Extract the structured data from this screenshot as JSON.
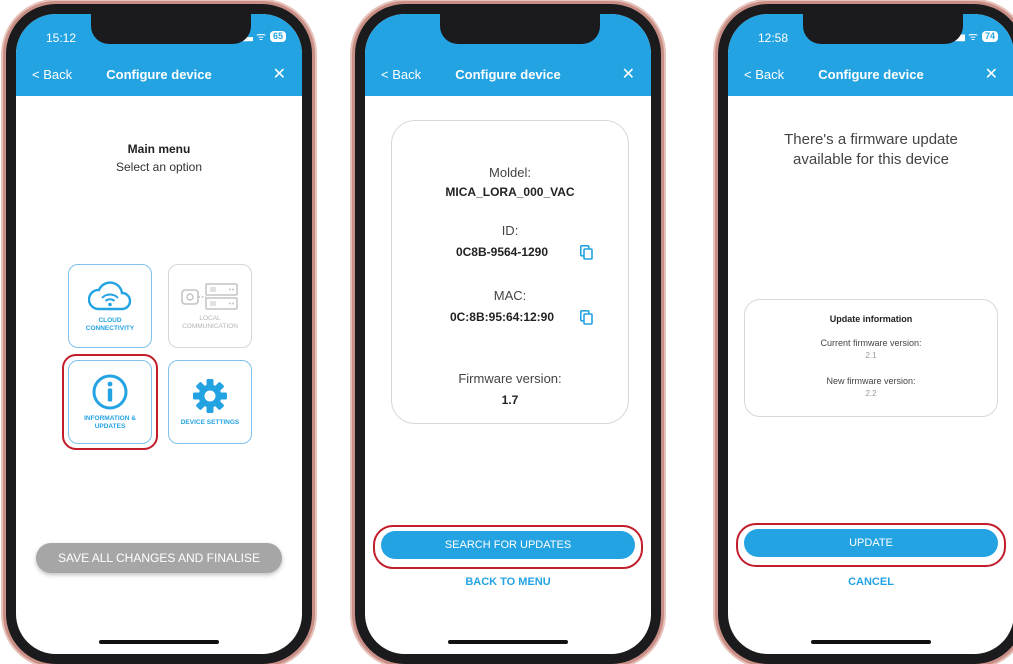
{
  "phone1": {
    "time": "15:12",
    "battery": "65",
    "back": "< Back",
    "title": "Configure device",
    "close": "✕",
    "menu_title": "Main menu",
    "menu_subtitle": "Select an option",
    "tiles": {
      "cloud": "CLOUD CONNECTIVITY",
      "local": "LOCAL COMMUNICATION",
      "info": "INFORMATION & UPDATES",
      "settings": "DEVICE SETTINGS"
    },
    "save_button": "SAVE ALL CHANGES AND FINALISE"
  },
  "phone2": {
    "back": "< Back",
    "title": "Configure device",
    "close": "✕",
    "model_label": "Moldel:",
    "model_value": "MICA_LORA_000_VAC",
    "id_label": "ID:",
    "id_value": "0C8B-9564-1290",
    "mac_label": "MAC:",
    "mac_value": "0C:8B:95:64:12:90",
    "fw_label": "Firmware version:",
    "fw_value": "1.7",
    "search_button": "SEARCH FOR UPDATES",
    "back_menu": "BACK TO MENU"
  },
  "phone3": {
    "time": "12:58",
    "battery": "74",
    "back": "< Back",
    "title": "Configure device",
    "close": "✕",
    "message_line1": "There's a firmware update",
    "message_line2": "available for this device",
    "info_title": "Update information",
    "current_label": "Current firmware version:",
    "current_value": "2.1",
    "new_label": "New firmware version:",
    "new_value": "2.2",
    "update_button": "UPDATE",
    "cancel_button": "CANCEL"
  },
  "colors": {
    "accent": "#24a3e3",
    "highlight": "#c21d2b",
    "disabled_button": "#a6a6a6",
    "phone_frame": "#c98f86"
  }
}
